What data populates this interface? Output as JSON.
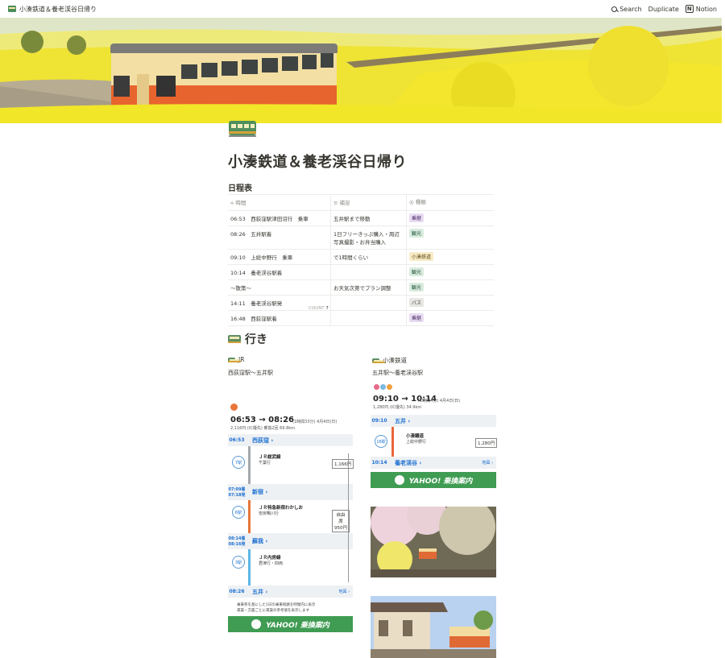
{
  "topbar": {
    "breadcrumb": "小湊鉄道＆養老渓谷日帰り",
    "search": "Search",
    "duplicate": "Duplicate",
    "notion": "Notion"
  },
  "page": {
    "title": "小湊鉄道＆養老渓谷日帰り",
    "schedule_heading": "日程表"
  },
  "table": {
    "headers": [
      "時間",
      "補足",
      "種類"
    ],
    "rows": [
      {
        "time": "06:53　西荻窪駅津田沼行　乗車",
        "note": "五井駅まで移動",
        "tag": "乗継",
        "tag_color": "purple"
      },
      {
        "time": "08:26　五井駅着",
        "note": "1日フリーきっぷ購入・周辺写真撮影・お弁当購入",
        "tag": "観光",
        "tag_color": "green"
      },
      {
        "time": "09:10　上総中野行　乗車",
        "note": "で1時間くらい",
        "tag": "小湊鉄道",
        "tag_color": "yellow"
      },
      {
        "time": "10:14　養老渓谷駅着",
        "note": "",
        "tag": "観光",
        "tag_color": "green"
      },
      {
        "time": "〜散策〜",
        "note": "お天気次第でプラン調整",
        "tag": "観光",
        "tag_color": "green"
      },
      {
        "time": "14:11　養老渓谷駅発",
        "note": "",
        "tag": "バス",
        "tag_color": "gray"
      },
      {
        "time": "16:48　西荻窪駅着",
        "note": "",
        "tag": "乗継",
        "tag_color": "purple"
      }
    ],
    "count_label": "COUNT",
    "count_value": "7"
  },
  "section_go": {
    "heading": "行き",
    "left": {
      "heading": "JR",
      "sub": "西荻窪駅〜五井駅",
      "time": "06:53 → 08:26",
      "time_note": "(1時間33分) 4月4日(日)",
      "fare_line": "2,116円 (IC優先) 乗換2回 69.8km",
      "stops": [
        {
          "time": "06:53",
          "name": "西荻窪"
        },
        {
          "time": "07:09着 07:18発",
          "name": "新宿"
        },
        {
          "time": "08:14着 08:16発",
          "name": "蘇我"
        },
        {
          "time": "08:26",
          "name": "五井"
        }
      ],
      "lines": [
        "ＪＲ総武線",
        "ＪＲ特急新宿わかしお",
        "ＪＲ内房線"
      ],
      "line_notes": [
        "千葉行",
        "安房鴨川行",
        "君津行・四両"
      ],
      "rides": [
        "7駅",
        "6駅",
        "3駅"
      ],
      "fares": [
        "1,166円",
        "自由席 950円"
      ],
      "map_link": "地図",
      "footnote": "乗車券を基にした1日の乗車経路を時間内に表示",
      "footnote2": "運賃・方面ごとに運賃の参考値を表示します",
      "banner": "YAHOO! 乗換案内"
    },
    "right": {
      "heading": "小湊鉄道",
      "sub": "五井駅〜養老渓谷駅",
      "time": "09:10 → 10:14",
      "time_note": "(1時間4分) 4月4日(日)",
      "fare_line": "1,280円 (IC優先) 34.9km",
      "stops": [
        {
          "time": "09:10",
          "name": "五井"
        },
        {
          "time": "10:14",
          "name": "養老渓谷"
        }
      ],
      "line": "小湊鐵道",
      "line_note": "上総中野行",
      "ride": "16駅",
      "fare": "1,280円",
      "map_link": "地図",
      "banner": "YAHOO! 乗換案内"
    }
  },
  "colors": {
    "cover_yellow": "#f1e531",
    "train_orange": "#e8642e",
    "train_cream": "#f4dfa5",
    "yahoo_green": "#3f9c52",
    "link_blue": "#1a6fd1"
  }
}
